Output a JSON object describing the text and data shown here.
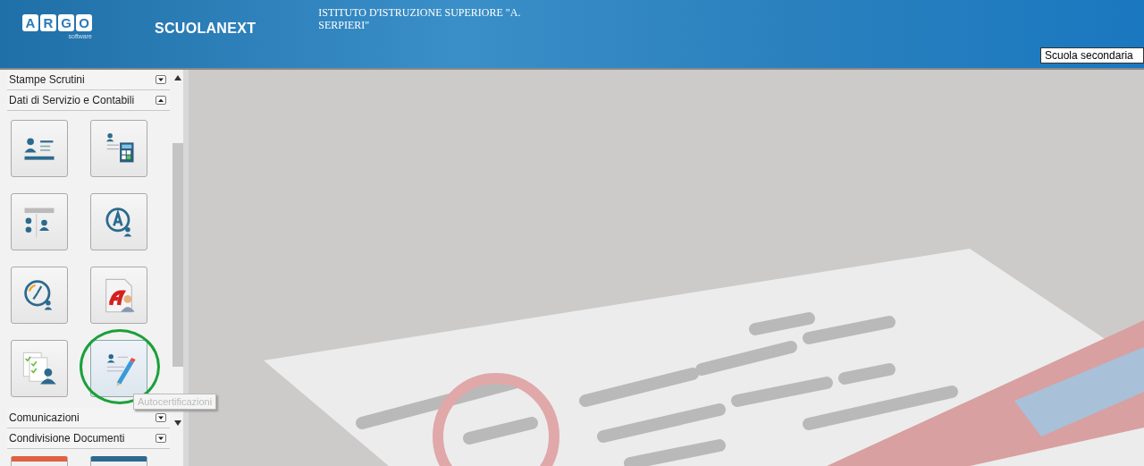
{
  "header": {
    "logo_letters": [
      "A",
      "R",
      "G",
      "O"
    ],
    "logo_sub": "software",
    "product": "SCUOLANEXT",
    "institute": "ISTITUTO D'ISTRUZIONE SUPERIORE \"A. SERPIERI\"",
    "school_select": "Scuola secondaria"
  },
  "sidebar": {
    "sections": [
      {
        "label": "Stampe Scrutini",
        "expanded": false
      },
      {
        "label": "Dati di Servizio e Contabili",
        "expanded": true,
        "tiles": [
          {
            "selected": false
          },
          {
            "selected": false
          },
          {
            "selected": false
          },
          {
            "selected": false
          },
          {
            "selected": false
          },
          {
            "selected": false
          },
          {
            "selected": false
          },
          {
            "selected": true
          }
        ]
      },
      {
        "label": "Comunicazioni",
        "expanded": false
      },
      {
        "label": "Condivisione Documenti",
        "expanded": false
      }
    ],
    "tooltip": "Autocertificazioni"
  }
}
